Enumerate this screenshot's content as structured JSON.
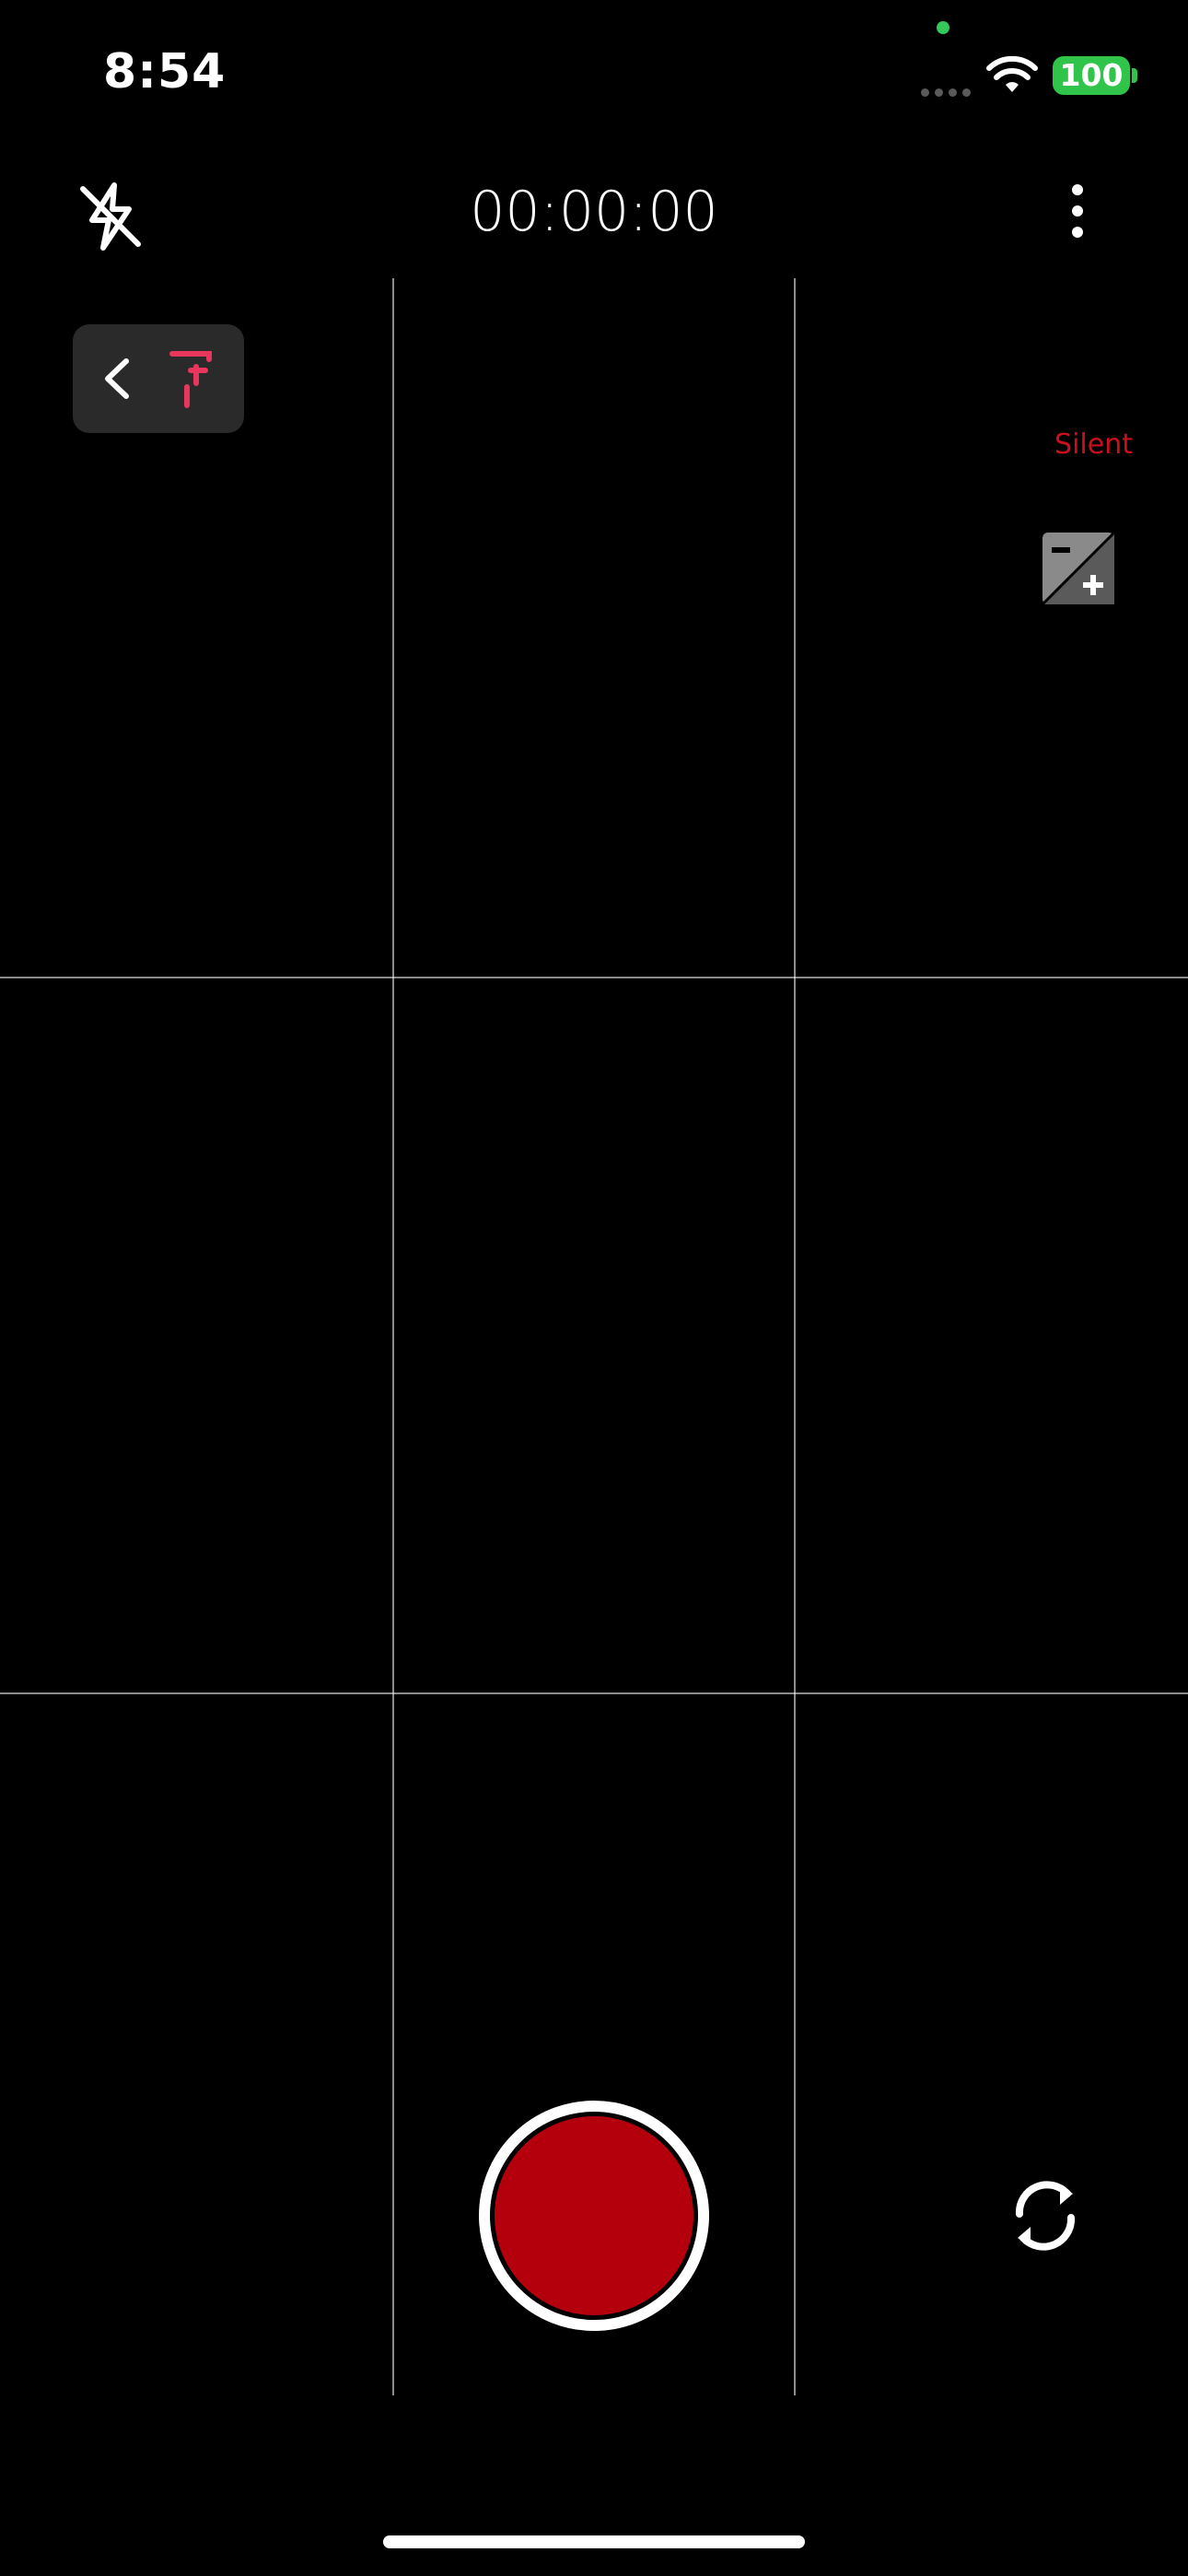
{
  "status_bar": {
    "time": "8:54",
    "battery": "100",
    "battery_color": "#31c44a",
    "wifi_icon": "wifi-icon",
    "signal_icon": "cellular-dots-icon"
  },
  "top_bar": {
    "flash_icon": "flash-off-icon",
    "timer": "00:00:00",
    "more_icon": "more-vertical-icon"
  },
  "side": {
    "back_icon": "chevron-left-icon",
    "app_icon": "app-logo-icon",
    "silent_label": "Silent",
    "exposure_icon": "exposure-icon"
  },
  "bottom": {
    "record_icon": "record-button",
    "record_color": "#b3000c",
    "flip_icon": "flip-camera-icon"
  }
}
